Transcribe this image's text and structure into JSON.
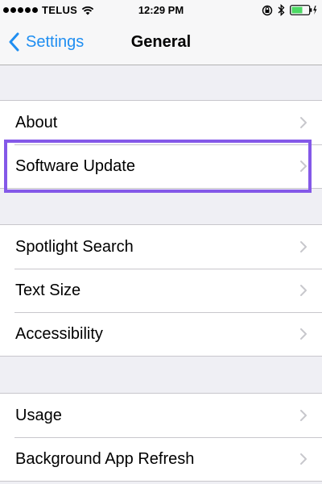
{
  "status_bar": {
    "carrier": "TELUS",
    "time": "12:29 PM",
    "signal_icon": "signal-dots-icon",
    "wifi_icon": "wifi-icon",
    "orientation_lock_icon": "orientation-lock-icon",
    "bluetooth_icon": "bluetooth-icon",
    "battery_icon": "battery-charging-icon",
    "battery_color": "#4cd964"
  },
  "nav": {
    "back_label": "Settings",
    "back_icon": "chevron-left-icon",
    "title": "General",
    "accent": "#1f8ef1"
  },
  "groups": [
    {
      "items": [
        {
          "label": "About"
        },
        {
          "label": "Software Update",
          "highlighted": true
        }
      ]
    },
    {
      "items": [
        {
          "label": "Spotlight Search"
        },
        {
          "label": "Text Size"
        },
        {
          "label": "Accessibility"
        }
      ]
    },
    {
      "items": [
        {
          "label": "Usage"
        },
        {
          "label": "Background App Refresh"
        }
      ]
    }
  ],
  "highlight_color": "#8459e8"
}
